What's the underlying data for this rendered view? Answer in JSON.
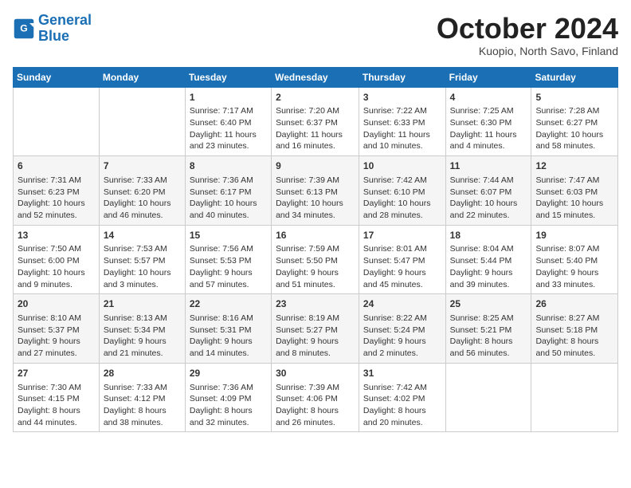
{
  "header": {
    "logo_line1": "General",
    "logo_line2": "Blue",
    "title": "October 2024",
    "subtitle": "Kuopio, North Savo, Finland"
  },
  "columns": [
    "Sunday",
    "Monday",
    "Tuesday",
    "Wednesday",
    "Thursday",
    "Friday",
    "Saturday"
  ],
  "weeks": [
    [
      {
        "day": "",
        "content": ""
      },
      {
        "day": "",
        "content": ""
      },
      {
        "day": "1",
        "content": "Sunrise: 7:17 AM\nSunset: 6:40 PM\nDaylight: 11 hours\nand 23 minutes."
      },
      {
        "day": "2",
        "content": "Sunrise: 7:20 AM\nSunset: 6:37 PM\nDaylight: 11 hours\nand 16 minutes."
      },
      {
        "day": "3",
        "content": "Sunrise: 7:22 AM\nSunset: 6:33 PM\nDaylight: 11 hours\nand 10 minutes."
      },
      {
        "day": "4",
        "content": "Sunrise: 7:25 AM\nSunset: 6:30 PM\nDaylight: 11 hours\nand 4 minutes."
      },
      {
        "day": "5",
        "content": "Sunrise: 7:28 AM\nSunset: 6:27 PM\nDaylight: 10 hours\nand 58 minutes."
      }
    ],
    [
      {
        "day": "6",
        "content": "Sunrise: 7:31 AM\nSunset: 6:23 PM\nDaylight: 10 hours\nand 52 minutes."
      },
      {
        "day": "7",
        "content": "Sunrise: 7:33 AM\nSunset: 6:20 PM\nDaylight: 10 hours\nand 46 minutes."
      },
      {
        "day": "8",
        "content": "Sunrise: 7:36 AM\nSunset: 6:17 PM\nDaylight: 10 hours\nand 40 minutes."
      },
      {
        "day": "9",
        "content": "Sunrise: 7:39 AM\nSunset: 6:13 PM\nDaylight: 10 hours\nand 34 minutes."
      },
      {
        "day": "10",
        "content": "Sunrise: 7:42 AM\nSunset: 6:10 PM\nDaylight: 10 hours\nand 28 minutes."
      },
      {
        "day": "11",
        "content": "Sunrise: 7:44 AM\nSunset: 6:07 PM\nDaylight: 10 hours\nand 22 minutes."
      },
      {
        "day": "12",
        "content": "Sunrise: 7:47 AM\nSunset: 6:03 PM\nDaylight: 10 hours\nand 15 minutes."
      }
    ],
    [
      {
        "day": "13",
        "content": "Sunrise: 7:50 AM\nSunset: 6:00 PM\nDaylight: 10 hours\nand 9 minutes."
      },
      {
        "day": "14",
        "content": "Sunrise: 7:53 AM\nSunset: 5:57 PM\nDaylight: 10 hours\nand 3 minutes."
      },
      {
        "day": "15",
        "content": "Sunrise: 7:56 AM\nSunset: 5:53 PM\nDaylight: 9 hours\nand 57 minutes."
      },
      {
        "day": "16",
        "content": "Sunrise: 7:59 AM\nSunset: 5:50 PM\nDaylight: 9 hours\nand 51 minutes."
      },
      {
        "day": "17",
        "content": "Sunrise: 8:01 AM\nSunset: 5:47 PM\nDaylight: 9 hours\nand 45 minutes."
      },
      {
        "day": "18",
        "content": "Sunrise: 8:04 AM\nSunset: 5:44 PM\nDaylight: 9 hours\nand 39 minutes."
      },
      {
        "day": "19",
        "content": "Sunrise: 8:07 AM\nSunset: 5:40 PM\nDaylight: 9 hours\nand 33 minutes."
      }
    ],
    [
      {
        "day": "20",
        "content": "Sunrise: 8:10 AM\nSunset: 5:37 PM\nDaylight: 9 hours\nand 27 minutes."
      },
      {
        "day": "21",
        "content": "Sunrise: 8:13 AM\nSunset: 5:34 PM\nDaylight: 9 hours\nand 21 minutes."
      },
      {
        "day": "22",
        "content": "Sunrise: 8:16 AM\nSunset: 5:31 PM\nDaylight: 9 hours\nand 14 minutes."
      },
      {
        "day": "23",
        "content": "Sunrise: 8:19 AM\nSunset: 5:27 PM\nDaylight: 9 hours\nand 8 minutes."
      },
      {
        "day": "24",
        "content": "Sunrise: 8:22 AM\nSunset: 5:24 PM\nDaylight: 9 hours\nand 2 minutes."
      },
      {
        "day": "25",
        "content": "Sunrise: 8:25 AM\nSunset: 5:21 PM\nDaylight: 8 hours\nand 56 minutes."
      },
      {
        "day": "26",
        "content": "Sunrise: 8:27 AM\nSunset: 5:18 PM\nDaylight: 8 hours\nand 50 minutes."
      }
    ],
    [
      {
        "day": "27",
        "content": "Sunrise: 7:30 AM\nSunset: 4:15 PM\nDaylight: 8 hours\nand 44 minutes."
      },
      {
        "day": "28",
        "content": "Sunrise: 7:33 AM\nSunset: 4:12 PM\nDaylight: 8 hours\nand 38 minutes."
      },
      {
        "day": "29",
        "content": "Sunrise: 7:36 AM\nSunset: 4:09 PM\nDaylight: 8 hours\nand 32 minutes."
      },
      {
        "day": "30",
        "content": "Sunrise: 7:39 AM\nSunset: 4:06 PM\nDaylight: 8 hours\nand 26 minutes."
      },
      {
        "day": "31",
        "content": "Sunrise: 7:42 AM\nSunset: 4:02 PM\nDaylight: 8 hours\nand 20 minutes."
      },
      {
        "day": "",
        "content": ""
      },
      {
        "day": "",
        "content": ""
      }
    ]
  ]
}
